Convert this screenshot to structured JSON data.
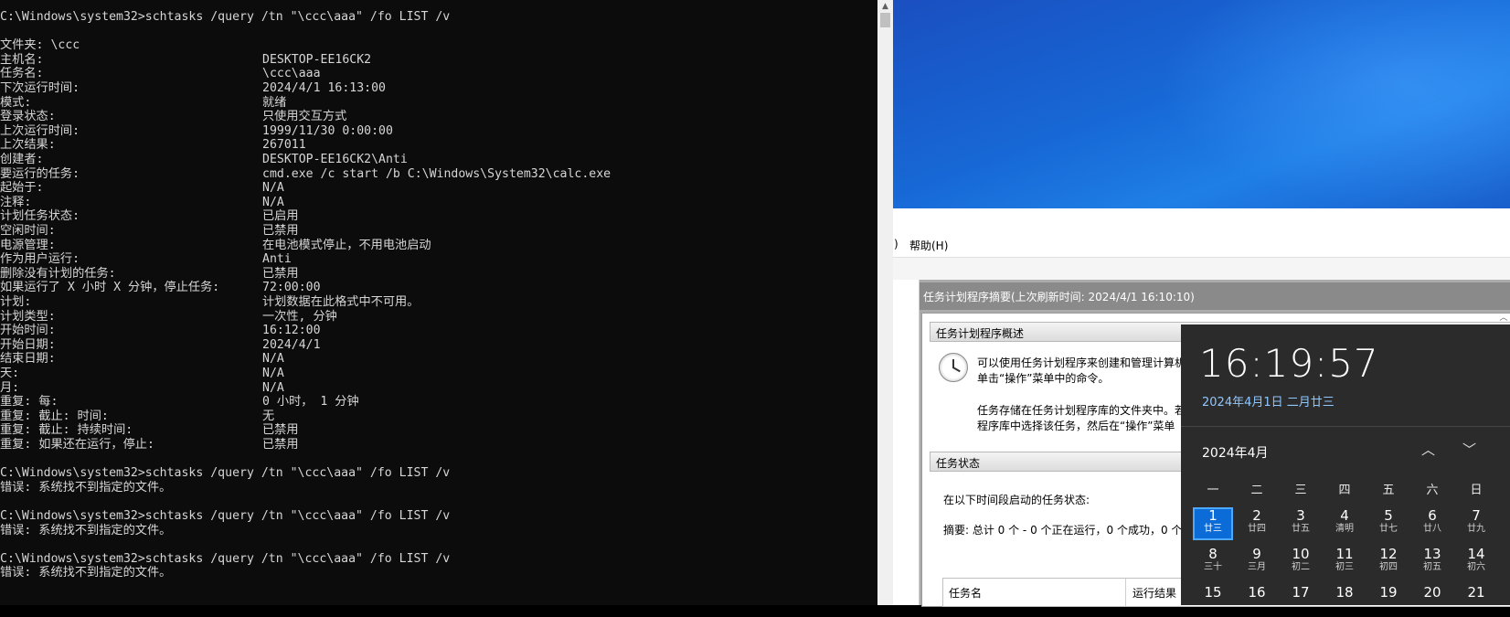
{
  "console": {
    "lines": [
      "C:\\Windows\\system32>schtasks /query /tn \"\\ccc\\aaa\" /fo LIST /v",
      "",
      "文件夹: \\ccc",
      "主机名:",
      "任务名:",
      "下次运行时间:",
      "模式:",
      "登录状态:",
      "上次运行时间:",
      "上次结果:",
      "创建者:",
      "要运行的任务:",
      "起始于:",
      "注释:",
      "计划任务状态:",
      "空闲时间:",
      "电源管理:",
      "作为用户运行:",
      "删除没有计划的任务:",
      "如果运行了 X 小时 X 分钟，停止任务:",
      "计划:",
      "计划类型:",
      "开始时间:",
      "开始日期:",
      "结束日期:",
      "天:",
      "月:",
      "重复: 每:",
      "重复: 截止: 时间:",
      "重复: 截止: 持续时间:",
      "重复: 如果还在运行，停止:",
      "",
      "C:\\Windows\\system32>schtasks /query /tn \"\\ccc\\aaa\" /fo LIST /v",
      "错误: 系统找不到指定的文件。",
      "",
      "C:\\Windows\\system32>schtasks /query /tn \"\\ccc\\aaa\" /fo LIST /v",
      "错误: 系统找不到指定的文件。",
      "",
      "C:\\Windows\\system32>schtasks /query /tn \"\\ccc\\aaa\" /fo LIST /v",
      "错误: 系统找不到指定的文件。"
    ],
    "values": [
      "DESKTOP-EE16CK2",
      "\\ccc\\aaa",
      "2024/4/1 16:13:00",
      "就绪",
      "只使用交互方式",
      "1999/11/30 0:00:00",
      "267011",
      "DESKTOP-EE16CK2\\Anti",
      "cmd.exe /c start /b C:\\Windows\\System32\\calc.exe",
      "N/A",
      "N/A",
      "已启用",
      "已禁用",
      "在电池模式停止，不用电池启动",
      "Anti",
      "已禁用",
      "72:00:00",
      "计划数据在此格式中不可用。",
      "一次性, 分钟",
      "16:12:00",
      "2024/4/1",
      "N/A",
      "N/A",
      "N/A",
      "0 小时， 1 分钟",
      "无",
      "已禁用",
      "已禁用"
    ]
  },
  "window": {
    "menu_partial": ")",
    "menu_help": "帮助(H)",
    "summary_title": "任务计划程序摘要(上次刷新时间: 2024/4/1 16:10:10)",
    "overview_header": "任务计划程序概述",
    "overview_text1": "可以使用任务计划程序来创建和管理计算机",
    "overview_text2": "单击“操作”菜单中的命令。",
    "overview_text3": "任务存储在任务计划程序库的文件夹中。若",
    "overview_text4": "程序库中选择该任务，然后在“操作”菜单",
    "status_header": "任务状态",
    "status_period_label": "在以下时间段启动的任务状态:",
    "status_summary": "摘要: 总计 0 个 - 0 个正在运行，0 个成功，0 个",
    "col_task_name": "任务名",
    "col_run_result": "运行结果",
    "icons": {
      "clock": "clock-icon",
      "scroll_up": "scroll-up-icon"
    }
  },
  "flyout": {
    "time": "16:19:57",
    "date": "2024年4月1日 二月廿三",
    "month_label": "2024年4月",
    "nav_up": "︿",
    "nav_down": "﹀",
    "weekdays": [
      "一",
      "二",
      "三",
      "四",
      "五",
      "六",
      "日"
    ],
    "days": [
      {
        "n": "1",
        "s": "廿三",
        "today": true
      },
      {
        "n": "2",
        "s": "廿四"
      },
      {
        "n": "3",
        "s": "廿五"
      },
      {
        "n": "4",
        "s": "清明"
      },
      {
        "n": "5",
        "s": "廿七"
      },
      {
        "n": "6",
        "s": "廿八"
      },
      {
        "n": "7",
        "s": "廿九"
      },
      {
        "n": "8",
        "s": "三十"
      },
      {
        "n": "9",
        "s": "三月"
      },
      {
        "n": "10",
        "s": "初二"
      },
      {
        "n": "11",
        "s": "初三"
      },
      {
        "n": "12",
        "s": "初四"
      },
      {
        "n": "13",
        "s": "初五"
      },
      {
        "n": "14",
        "s": "初六"
      },
      {
        "n": "15",
        "s": ""
      },
      {
        "n": "16",
        "s": ""
      },
      {
        "n": "17",
        "s": ""
      },
      {
        "n": "18",
        "s": ""
      },
      {
        "n": "19",
        "s": ""
      },
      {
        "n": "20",
        "s": ""
      },
      {
        "n": "21",
        "s": ""
      }
    ],
    "accent_color": "#0b6cd8"
  }
}
